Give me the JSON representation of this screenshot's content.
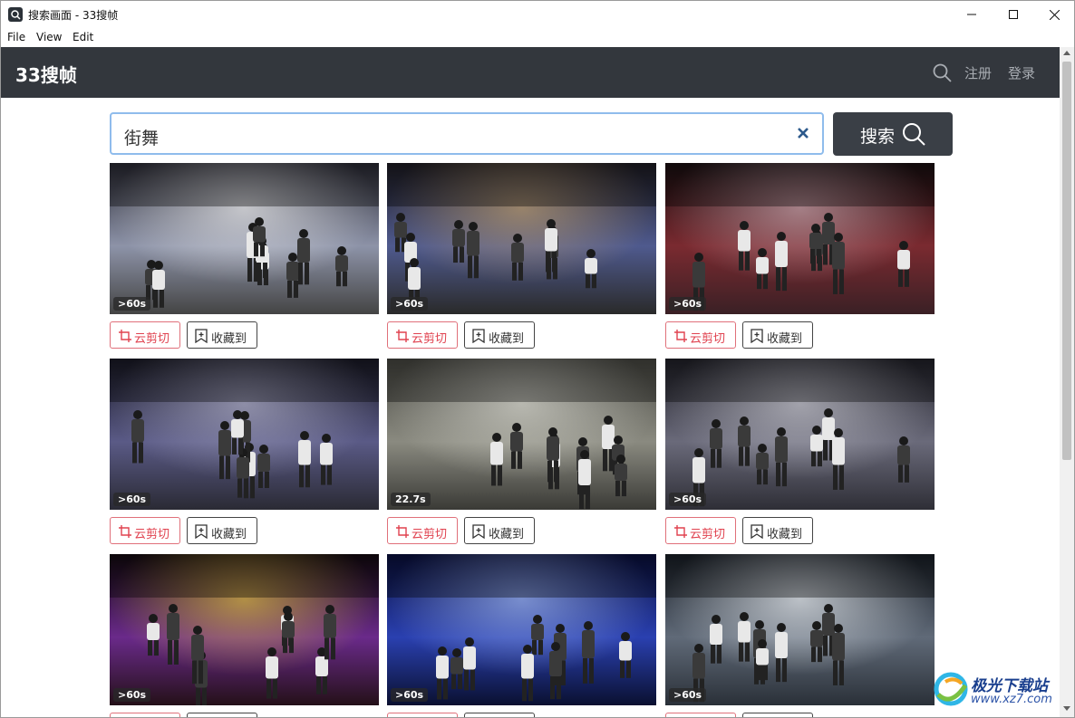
{
  "window": {
    "title": "搜索画面 - 33搜帧",
    "minimize_icon": "minimize-icon",
    "maximize_icon": "maximize-icon",
    "close_icon": "close-icon"
  },
  "menu": {
    "file": "File",
    "view": "View",
    "edit": "Edit"
  },
  "header": {
    "brand": "33搜帧",
    "register": "注册",
    "login": "登录",
    "bg_color": "#33373d"
  },
  "search": {
    "value": "街舞",
    "button_label": "搜索",
    "accent": "#8fbcec"
  },
  "actions": {
    "cut_label": "云剪切",
    "fav_label": "收藏到",
    "cut_color": "#e0424f"
  },
  "results": [
    {
      "duration": ">60s",
      "scene": "crew kneeling on stage"
    },
    {
      "duration": ">60s",
      "scene": "dancer crouching in arena"
    },
    {
      "duration": ">60s",
      "scene": "crowd facing red light"
    },
    {
      "duration": ">60s",
      "scene": "dancers circle in arena"
    },
    {
      "duration": "22.7s",
      "scene": "three dancers before graffiti wall"
    },
    {
      "duration": ">60s",
      "scene": "group crouching formation"
    },
    {
      "duration": ">60s",
      "scene": "neon purple dancers"
    },
    {
      "duration": ">60s",
      "scene": "blue stage silhouettes"
    },
    {
      "duration": ">60s",
      "scene": "spotlight dancers on stage"
    }
  ],
  "watermark": {
    "text": "极光下载站",
    "url": "www.xz7.com"
  }
}
